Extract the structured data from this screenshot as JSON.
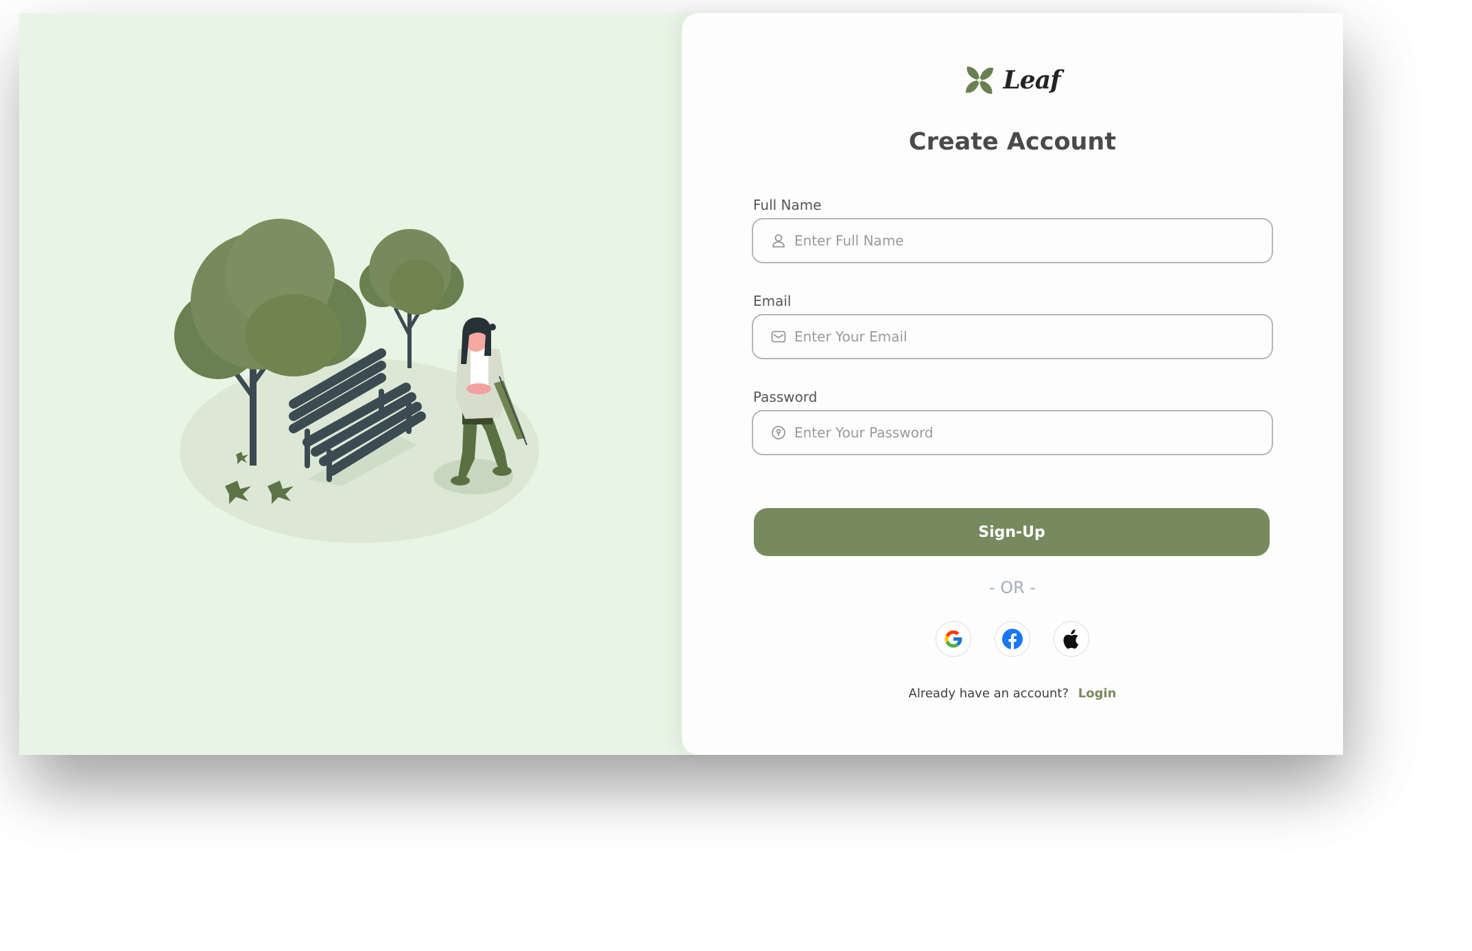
{
  "brand": {
    "name": "Leaf",
    "accent_color": "#778a5e",
    "panel_color": "#e8f5e4"
  },
  "form": {
    "title": "Create Account",
    "full_name": {
      "label": "Full Name",
      "placeholder": "Enter Full Name",
      "icon": "user-icon"
    },
    "email": {
      "label": "Email",
      "placeholder": "Enter Your Email",
      "icon": "mail-icon"
    },
    "password": {
      "label": "Password",
      "placeholder": "Enter Your Password",
      "icon": "lock-icon"
    },
    "submit_label": "Sign-Up",
    "divider": "- OR -",
    "socials": [
      "google-icon",
      "facebook-icon",
      "apple-icon"
    ],
    "login_prompt": "Already have an account?",
    "login_link": "Login"
  },
  "illustration": {
    "subject": "park-bench-walker-illustration"
  }
}
